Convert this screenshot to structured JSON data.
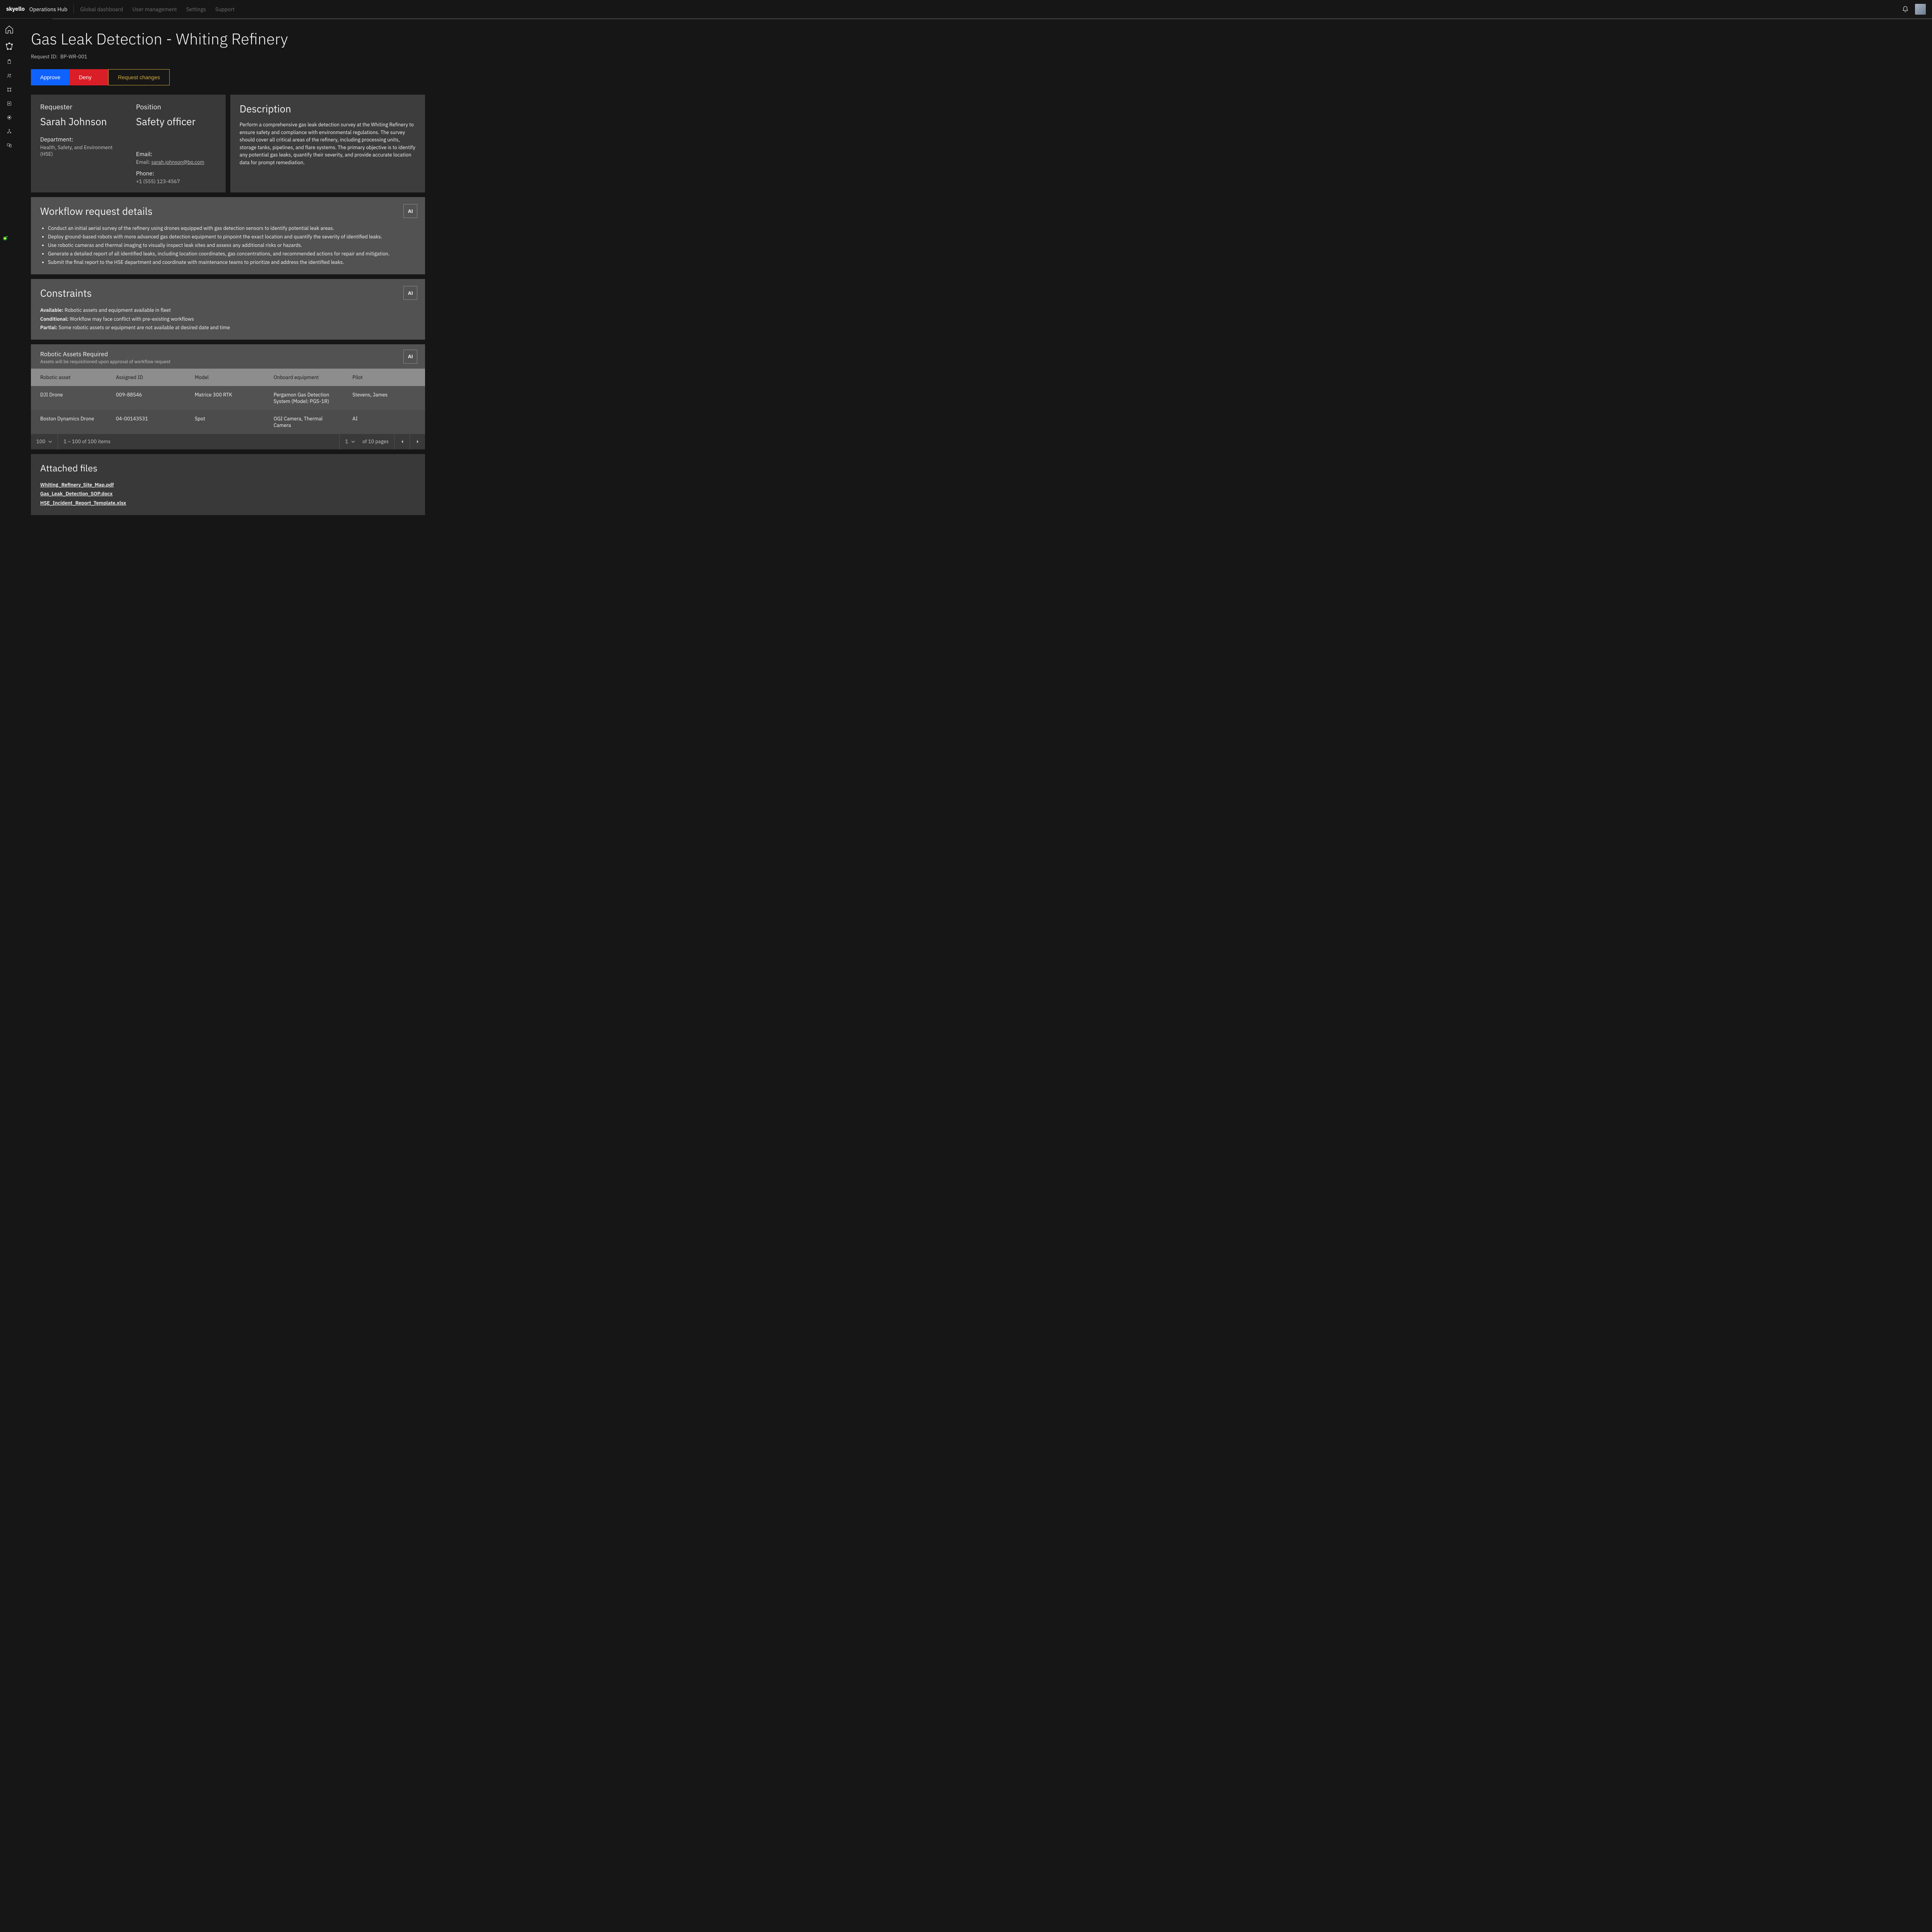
{
  "header": {
    "logo": "skyello",
    "section": "Operations Hub",
    "nav": [
      "Global dashboard",
      "User management",
      "Settings",
      "Support"
    ]
  },
  "sidebar": {
    "items": [
      "home",
      "polygon",
      "route",
      "clipboard",
      "users",
      "connections",
      "open-panel",
      "radio-button",
      "hierarchy",
      "devices"
    ]
  },
  "page": {
    "title": "Gas Leak Detection - Whiting Refinery",
    "request_id_label": "Request ID:",
    "request_id": "BP-WR-001"
  },
  "actions": {
    "approve": "Approve",
    "deny": "Deny",
    "request_changes": "Request changes"
  },
  "requester": {
    "label": "Requester",
    "name": "Sarah Johnson",
    "dept_label": "Department:",
    "dept": "Health, Safety, and Environment (HSE)"
  },
  "position": {
    "label": "Position",
    "value": "Safety officer",
    "email_label": "Email:",
    "email_prefix": "Email: ",
    "email": "sarah.johnson@bp.com",
    "phone_label": "Phone:",
    "phone": "+1 (555) 123-4567"
  },
  "description": {
    "title": "Description",
    "text": "Perform a comprehensive gas leak detection survey at the Whiting Refinery to ensure safety and compliance with environmental regulations. The survey should cover all critical areas of the refinery, including processing units, storage tanks, pipelines, and flare systems. The primary objective is to identify any potential gas leaks, quantify their severity, and provide accurate location data for prompt remediation."
  },
  "workflow": {
    "title": "Workflow request details",
    "items": [
      "Conduct an initial aerial survey of the refinery using drones equipped with gas detection sensors to identify potential leak areas.",
      "Deploy ground-based robots with more advanced gas detection equipment to pinpoint the exact location and quantify the severity of identified leaks.",
      "Use robotic cameras and thermal imaging to visually inspect leak sites and assess any additional risks or hazards.",
      "Generate a detailed report of all identified leaks, including location coordinates, gas concentrations, and recommended actions for repair and mitigation.",
      "Submit the final report to the HSE department and coordinate with maintenance teams to prioritize and address the identified leaks."
    ],
    "ai_label": "AI"
  },
  "constraints": {
    "title": "Constraints",
    "rows": [
      {
        "label": "Available:",
        "text": " Robotic assets and equipment available in fleet"
      },
      {
        "label": "Conditional:",
        "text": " Workflow may face conflict with pre-existing workflows"
      },
      {
        "label": "Partial:",
        "text": " Some robotic assets or equipment are not available at desired date and time"
      }
    ],
    "ai_label": "AI"
  },
  "assets": {
    "title": "Robotic Assets Required",
    "subtitle": "Assets will be requisitioned upon approval of workflow request",
    "ai_label": "AI",
    "columns": [
      "Robotic asset",
      "Assigned ID",
      "Model",
      "Onboard equipment",
      "Pilot"
    ],
    "rows": [
      {
        "asset": "DJI Drone",
        "id": "009-88546",
        "model": "Matrice 300 RTK",
        "equip": "Pergamon Gas Detection System (Model: PGS-1R)",
        "pilot": "Stevens, James"
      },
      {
        "asset": "Boston Dynamics Drone",
        "id": "04-00143531",
        "model": "Spot",
        "equip": "OGI Camera, Thermal Camera",
        "pilot": "AI"
      }
    ]
  },
  "pagination": {
    "per_page": "100",
    "range": "1 – 100 of 100 items",
    "page": "1",
    "pages_suffix": "of 10 pages"
  },
  "files": {
    "title": "Attached files",
    "items": [
      "Whiting_Refinery_Site_Map.pdf",
      "Gas_Leak_Detection_SOP.docx",
      "HSE_Incident_Report_Template.xlsx"
    ]
  }
}
